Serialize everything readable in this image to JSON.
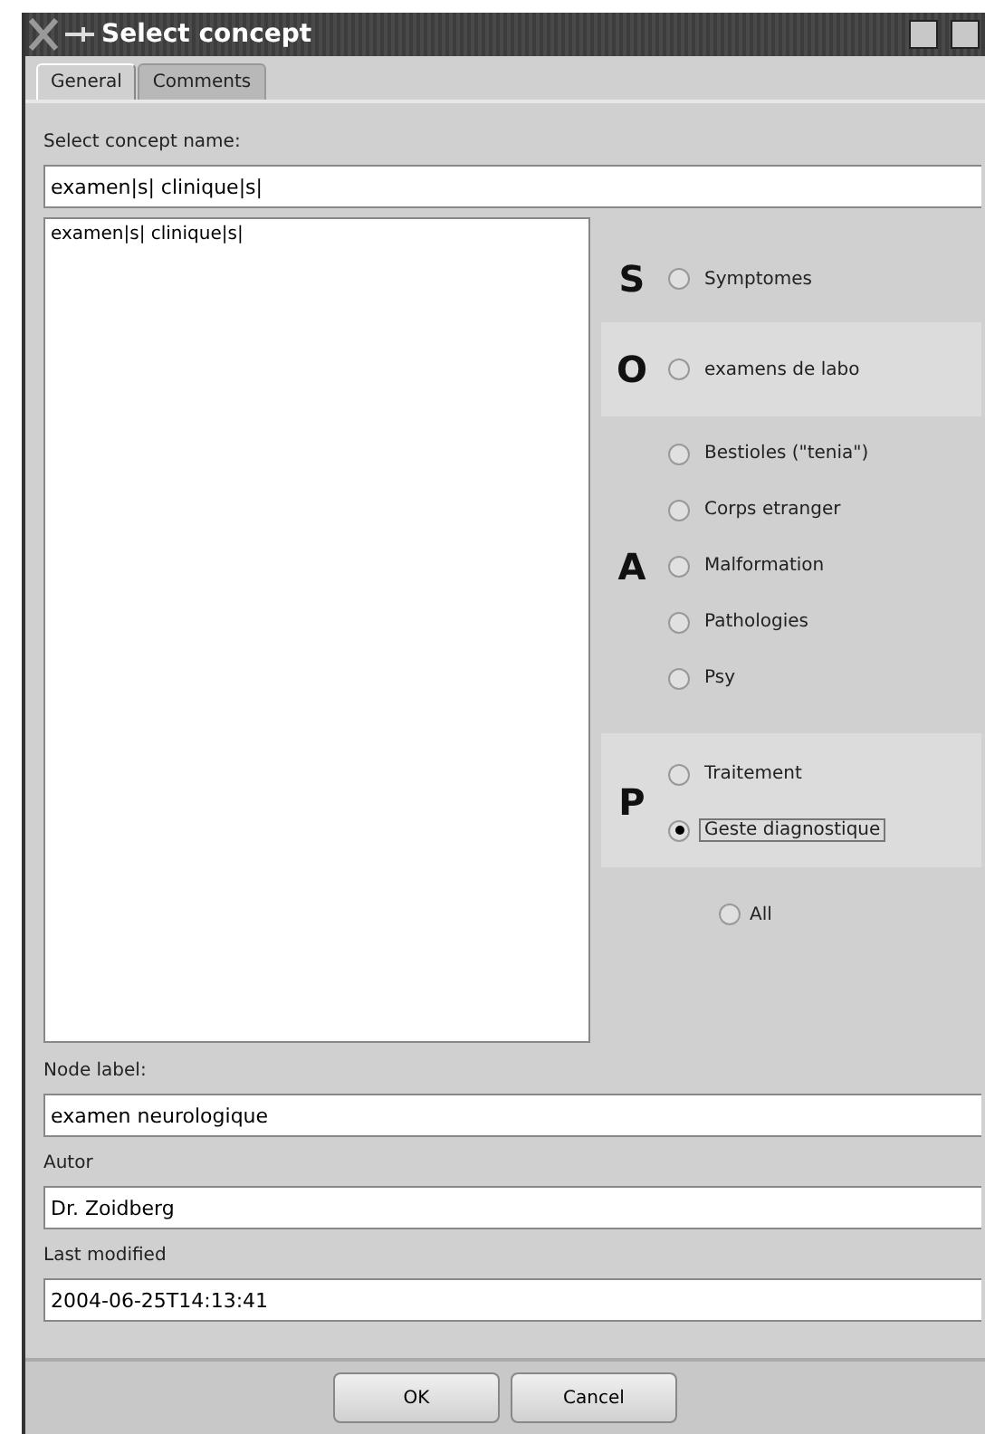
{
  "window": {
    "title": "Select concept"
  },
  "tabs": [
    {
      "label": "General",
      "selected": true
    },
    {
      "label": "Comments",
      "selected": false
    }
  ],
  "concept_name": {
    "label": "Select concept name:",
    "value": "examen|s| clinique|s|"
  },
  "results": {
    "items": [
      "examen|s| clinique|s|"
    ]
  },
  "groups": [
    {
      "letter": "S",
      "highlighted": false,
      "options": [
        {
          "label": "Symptomes",
          "selected": false,
          "focused": false
        }
      ]
    },
    {
      "letter": "O",
      "highlighted": true,
      "options": [
        {
          "label": "examens de labo",
          "selected": false,
          "focused": false
        }
      ]
    },
    {
      "letter": "A",
      "highlighted": false,
      "options": [
        {
          "label": "Bestioles (\"tenia\")",
          "selected": false,
          "focused": false
        },
        {
          "label": "Corps etranger",
          "selected": false,
          "focused": false
        },
        {
          "label": "Malformation",
          "selected": false,
          "focused": false
        },
        {
          "label": "Pathologies",
          "selected": false,
          "focused": false
        },
        {
          "label": "Psy",
          "selected": false,
          "focused": false
        }
      ]
    },
    {
      "letter": "P",
      "highlighted": true,
      "options": [
        {
          "label": "Traitement",
          "selected": false,
          "focused": false
        },
        {
          "label": "Geste diagnostique",
          "selected": true,
          "focused": true
        }
      ]
    }
  ],
  "all_option": {
    "label": "All",
    "selected": false
  },
  "fields": [
    {
      "label": "Node label:",
      "value": "examen neurologique"
    },
    {
      "label": "Autor",
      "value": "Dr. Zoidberg"
    },
    {
      "label": "Last modified",
      "value": "2004-06-25T14:13:41"
    }
  ],
  "buttons": [
    "OK",
    "Cancel"
  ]
}
